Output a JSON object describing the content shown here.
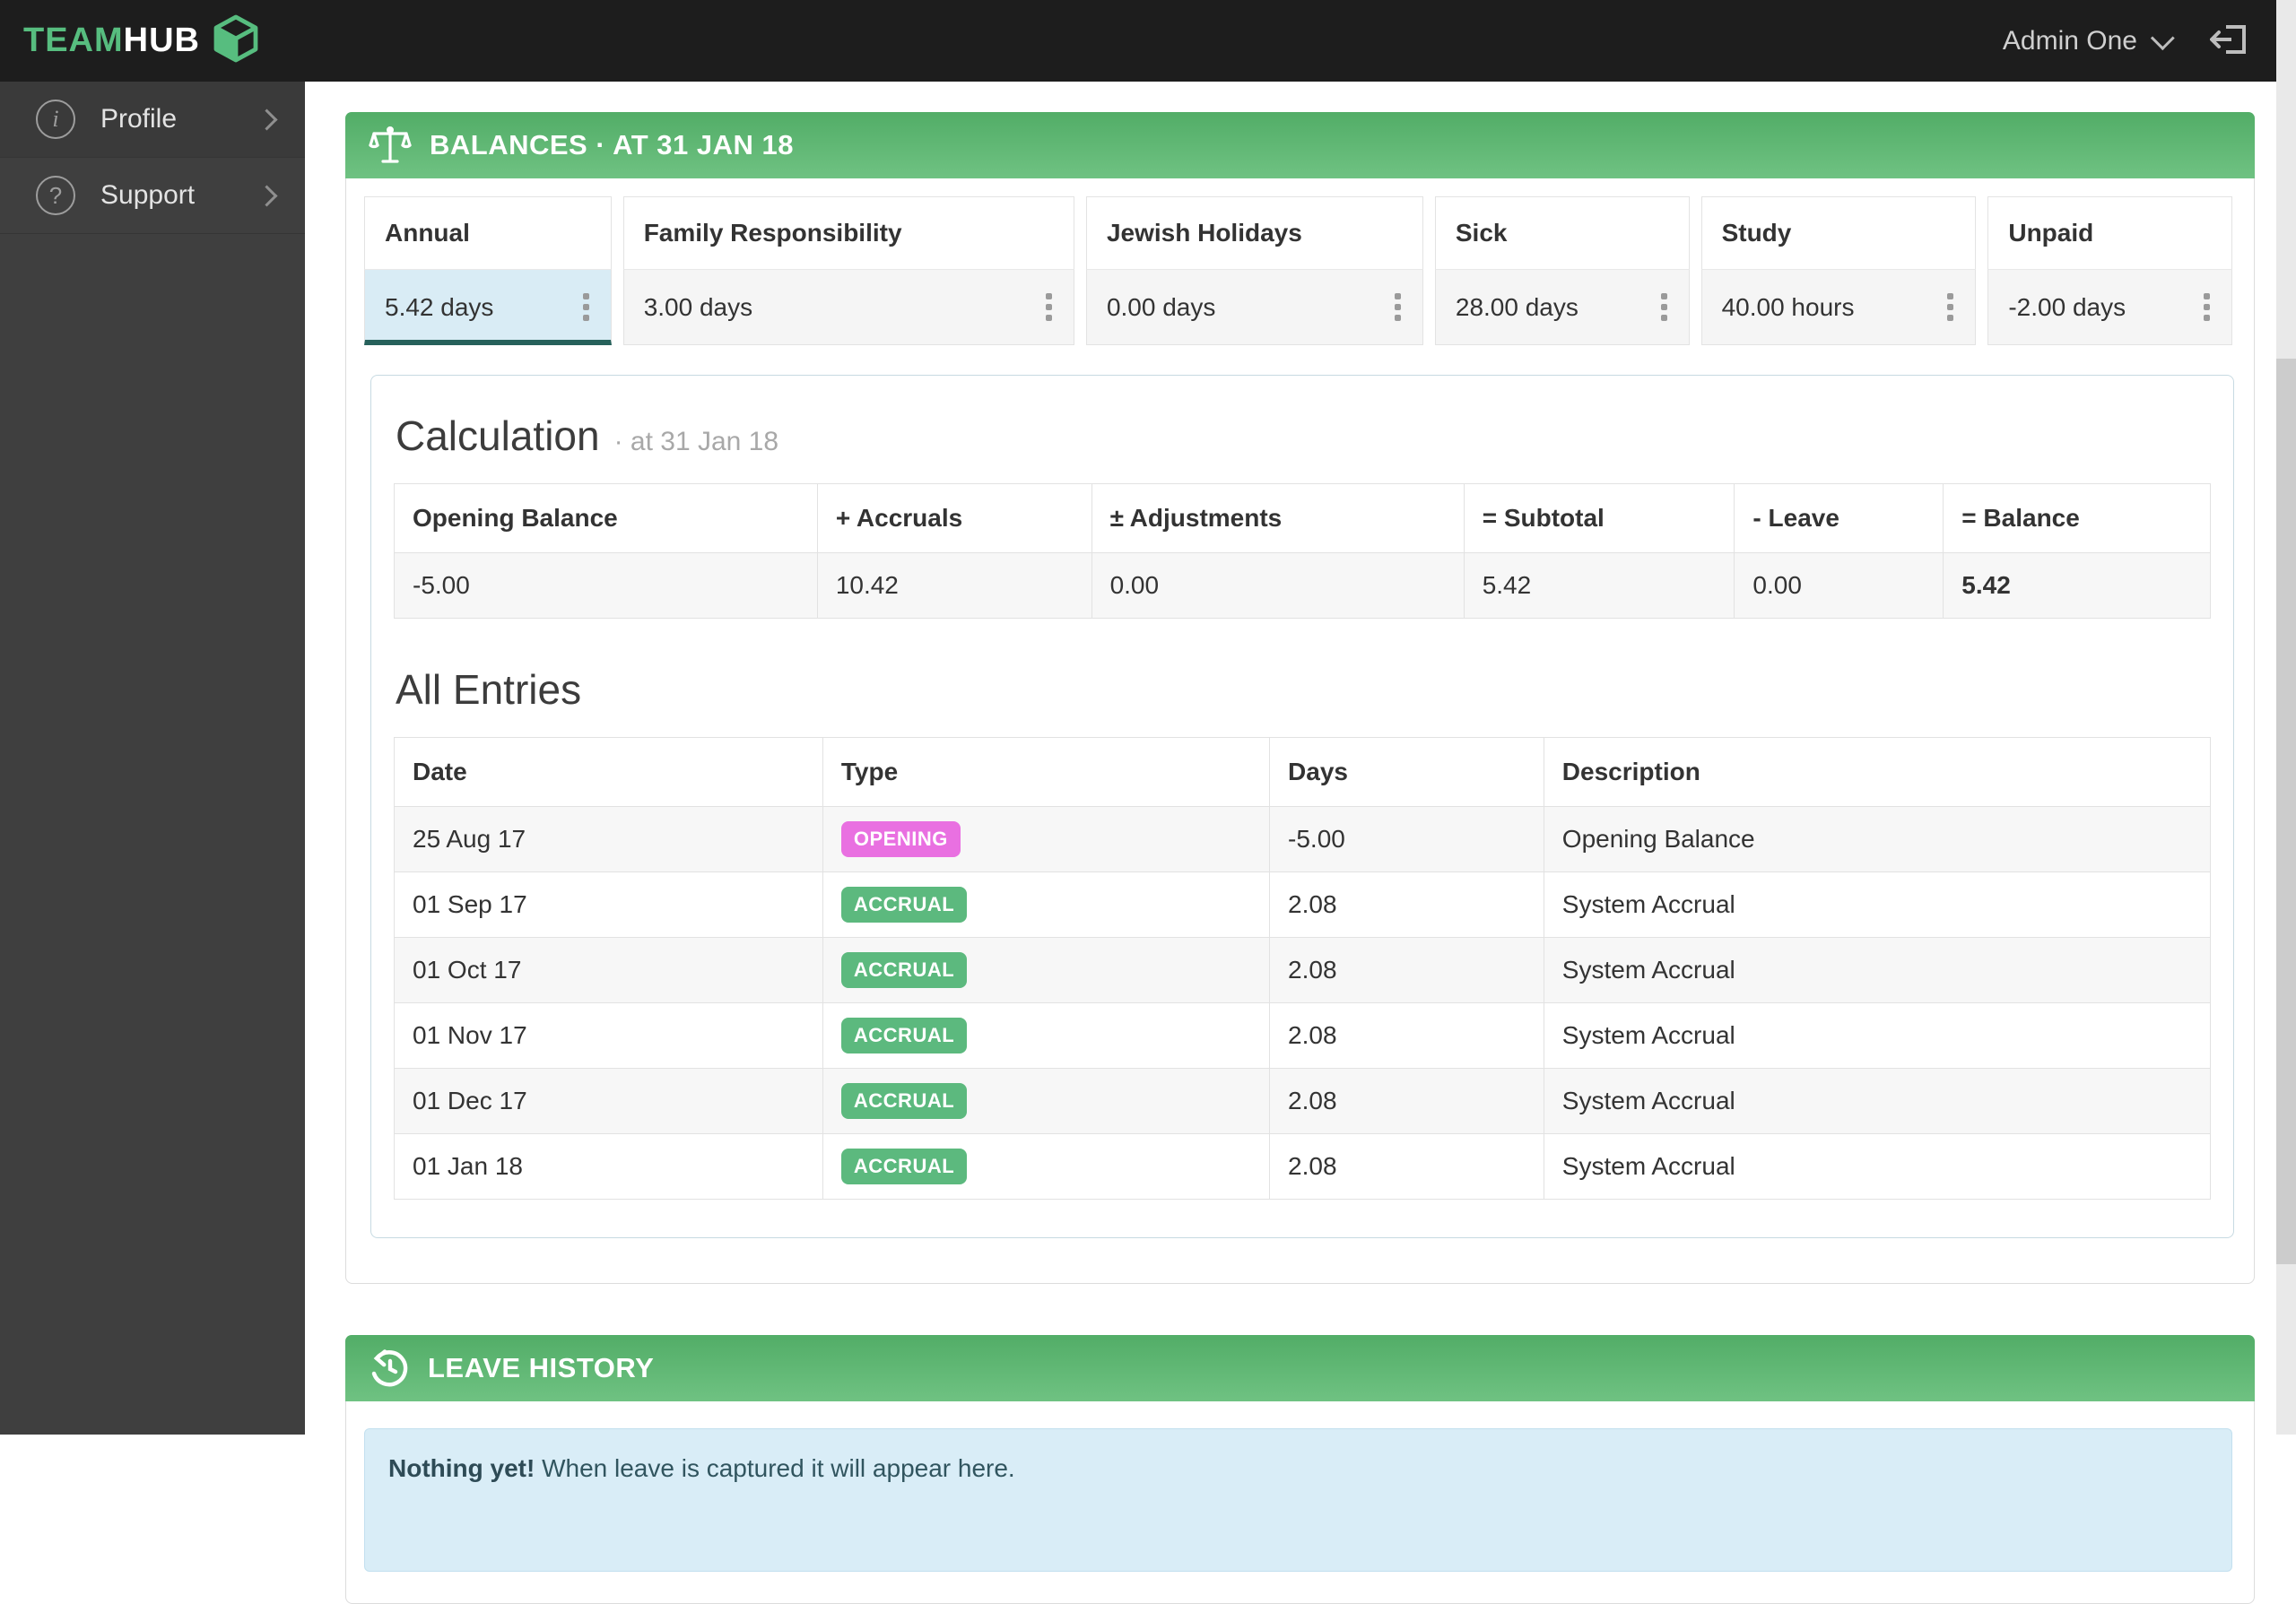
{
  "topbar": {
    "brand_team": "TEAM",
    "brand_hub": "HUB",
    "user_name": "Admin One"
  },
  "sidebar": {
    "items": [
      {
        "label": "Profile",
        "icon": "info-icon"
      },
      {
        "label": "Support",
        "icon": "question-icon"
      }
    ]
  },
  "balances": {
    "title": "BALANCES · AT 31 JAN 18",
    "cards": [
      {
        "type": "Annual",
        "value": "5.42 days",
        "selected": true
      },
      {
        "type": "Family Responsibility",
        "value": "3.00 days",
        "selected": false
      },
      {
        "type": "Jewish Holidays",
        "value": "0.00 days",
        "selected": false
      },
      {
        "type": "Sick",
        "value": "28.00 days",
        "selected": false
      },
      {
        "type": "Study",
        "value": "40.00 hours",
        "selected": false
      },
      {
        "type": "Unpaid",
        "value": "-2.00 days",
        "selected": false
      }
    ]
  },
  "calculation": {
    "title": "Calculation",
    "subtitle": "· at 31 Jan 18",
    "headers": [
      "Opening Balance",
      "+ Accruals",
      "± Adjustments",
      "= Subtotal",
      "- Leave",
      "= Balance"
    ],
    "values": [
      "-5.00",
      "10.42",
      "0.00",
      "5.42",
      "0.00",
      "5.42"
    ]
  },
  "entries": {
    "title": "All Entries",
    "headers": [
      "Date",
      "Type",
      "Days",
      "Description"
    ],
    "rows": [
      {
        "date": "25 Aug 17",
        "type": "OPENING",
        "days": "-5.00",
        "description": "Opening Balance"
      },
      {
        "date": "01 Sep 17",
        "type": "ACCRUAL",
        "days": "2.08",
        "description": "System Accrual"
      },
      {
        "date": "01 Oct 17",
        "type": "ACCRUAL",
        "days": "2.08",
        "description": "System Accrual"
      },
      {
        "date": "01 Nov 17",
        "type": "ACCRUAL",
        "days": "2.08",
        "description": "System Accrual"
      },
      {
        "date": "01 Dec 17",
        "type": "ACCRUAL",
        "days": "2.08",
        "description": "System Accrual"
      },
      {
        "date": "01 Jan 18",
        "type": "ACCRUAL",
        "days": "2.08",
        "description": "System Accrual"
      }
    ]
  },
  "leave_history": {
    "title": "LEAVE HISTORY",
    "empty_message_bold": "Nothing yet!",
    "empty_message_rest": " When leave is captured it will appear here."
  },
  "colors": {
    "brand_green": "#57bd7f",
    "header_gradient_top": "#52ad67",
    "header_gradient_bottom": "#6fc282",
    "accrual_badge": "#5cb97e",
    "opening_badge": "#e970e1",
    "selected_card_bg": "#d9ecf5",
    "selected_card_border": "#26615b",
    "info_box_bg": "#d9edf7",
    "topbar_bg": "#1d1d1d",
    "sidebar_bg": "#3f3f3f"
  }
}
